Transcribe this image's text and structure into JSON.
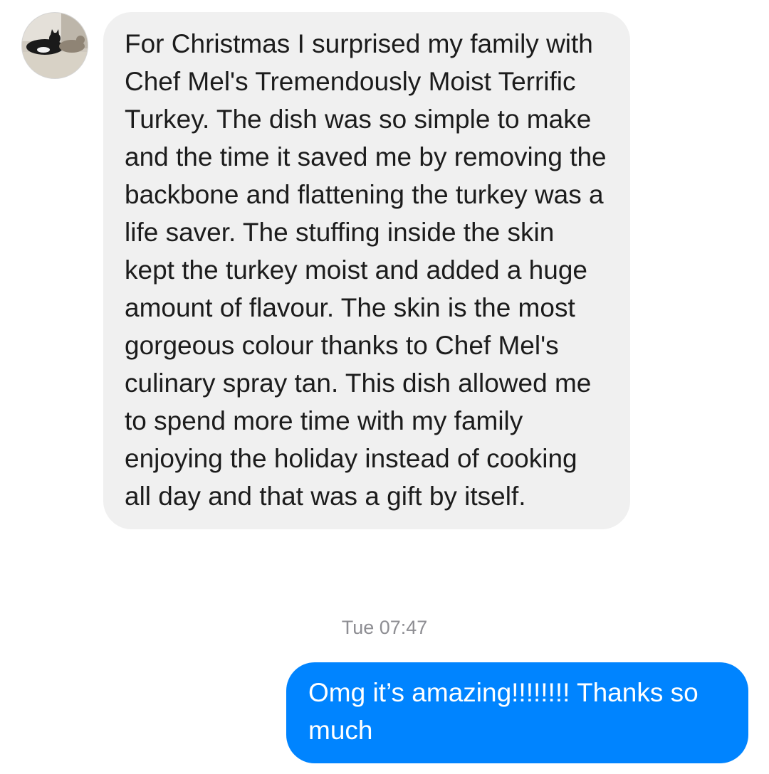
{
  "conversation": {
    "incoming": {
      "avatar_icon": "cat-avatar-icon",
      "text": "For Christmas I surprised my family with Chef Mel's Tremendously Moist Terrific Turkey. The dish was so simple to make and the time it saved me by removing the backbone and flattening the turkey was a life saver. The stuffing inside the skin kept the turkey moist and added a huge amount of flavour. The skin is the most gorgeous colour thanks to Chef Mel's culinary spray tan. This dish allowed me to spend more time with my family enjoying the holiday instead of cooking all day and that was a gift by itself."
    },
    "timestamp": "Tue 07:47",
    "outgoing": {
      "text": "Omg it’s amazing!!!!!!!! Thanks so much"
    }
  },
  "colors": {
    "incoming_bubble": "#f0f0f0",
    "outgoing_bubble": "#0084ff",
    "timestamp": "#8e8e93"
  }
}
